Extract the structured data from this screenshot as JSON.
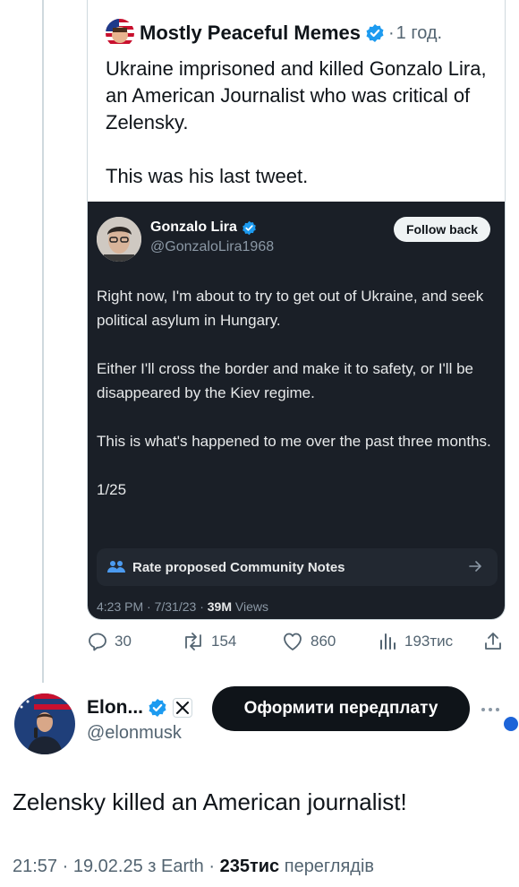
{
  "quoted_post": {
    "author": "Mostly Peaceful Memes",
    "time": "1 год.",
    "text": "Ukraine imprisoned and killed Gonzalo Lira, an American Journalist who was critical of Zelensky.\n\nThis was his last tweet."
  },
  "embedded_tweet": {
    "name": "Gonzalo Lira",
    "handle": "@GonzaloLira1968",
    "follow_label": "Follow back",
    "text": "Right now, I'm about to try to get out of Ukraine, and seek political asylum in Hungary.\n\nEither I'll cross the border and make it to safety, or I'll be disappeared by the Kiev regime.\n\nThis is what's happened to me over the past three months.\n\n1/25",
    "community_notes_label": "Rate proposed Community Notes",
    "time": "4:23 PM",
    "date": "7/31/23",
    "views": "39M",
    "views_label": "Views"
  },
  "actions": {
    "replies": "30",
    "reposts": "154",
    "likes": "860",
    "views": "193тис"
  },
  "reply_post": {
    "name": "Elon...",
    "handle": "@elonmusk",
    "subscribe_label": "Оформити передплату",
    "text": "Zelensky killed an American journalist!",
    "time": "21:57",
    "date": "19.02.25",
    "location": "з Earth",
    "views": "235тис",
    "views_label": "переглядів"
  },
  "colors": {
    "verified": "#1d9bf0",
    "embed_bg": "#1a1f27",
    "notes_icon": "#4c9bf0"
  }
}
